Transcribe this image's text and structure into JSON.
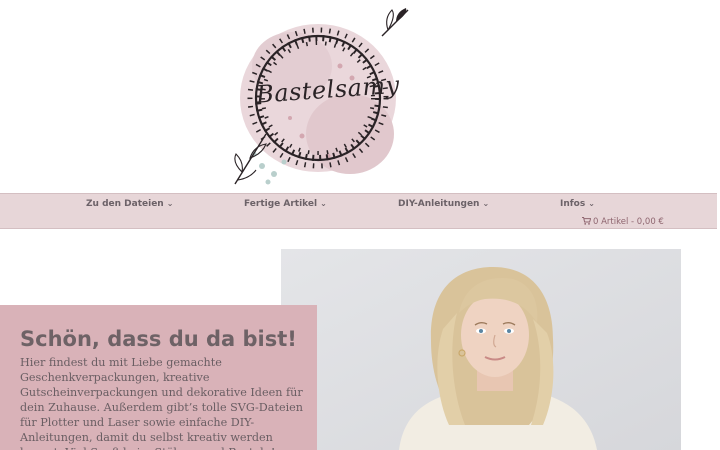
{
  "brand": {
    "logo_text": "Bastelsamy"
  },
  "nav": {
    "items": [
      {
        "label": "Zu den Dateien"
      },
      {
        "label": "Fertige Artikel"
      },
      {
        "label": "DIY-Anleitungen"
      },
      {
        "label": "Infos"
      }
    ],
    "cart_label": "0 Artikel - 0,00 €"
  },
  "hero": {
    "title": "Schön, dass du da bist!",
    "text": "Hier findest du mit Liebe gemachte Geschenkverpackungen, kreative Gutscheinverpackungen und dekorative Ideen für dein Zuhause. Außerdem gibt’s tolle SVG-Dateien für Plotter und Laser sowie einfache DIY-Anleitungen, damit du selbst kreativ werden kannst. Viel Spaß beim Stöbern und Basteln!"
  },
  "colors": {
    "nav_bg": "#e7d6d8",
    "intro_bg": "#d9b2b8",
    "accent": "#8f6670"
  },
  "icons": {
    "cart": "shopping-cart-icon",
    "dropdown": "chevron-down-icon"
  }
}
